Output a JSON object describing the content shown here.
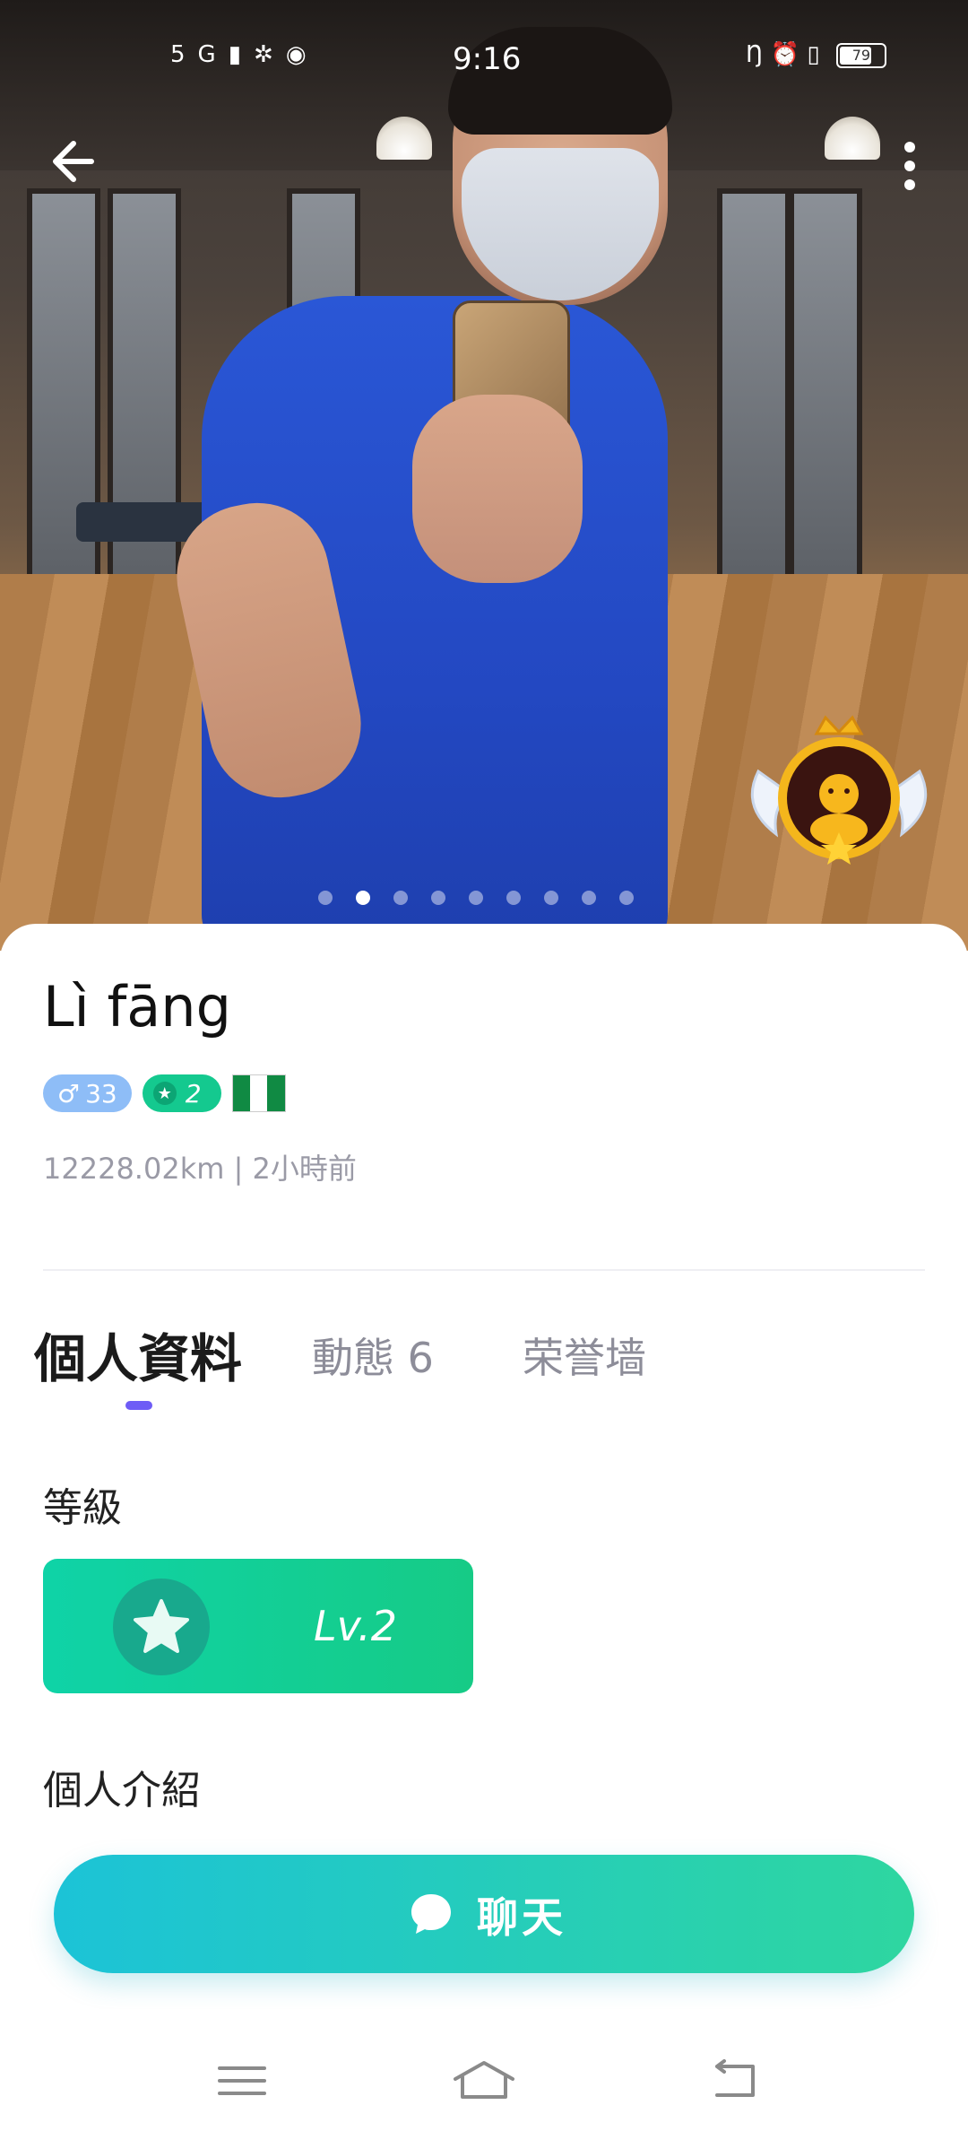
{
  "status_bar": {
    "time": "9:16",
    "network": "5G",
    "battery_level": "79",
    "battery_fraction": 0.79
  },
  "hero": {
    "photo_page_count": 9,
    "active_photo_index": 1
  },
  "profile": {
    "name": "Lì fāng",
    "gender_symbol": "♂",
    "age": "33",
    "level_badge": "2",
    "flag": "Nigeria",
    "meta": "12228.02km | 2小時前"
  },
  "tabs": {
    "profile": "個人資料",
    "feed": "動態 6",
    "honor": "荣誉墙"
  },
  "sections": {
    "level_title": "等級",
    "level_value": "Lv.2",
    "intro_title": "個人介紹"
  },
  "actions": {
    "chat_label": "聊天"
  },
  "colors": {
    "accent": "#6e5cf6",
    "level_green": "#14c98f",
    "gender_blue": "#8ebdf7",
    "chat_gradient_start": "#1cc3d7",
    "chat_gradient_end": "#2ed6a0"
  }
}
